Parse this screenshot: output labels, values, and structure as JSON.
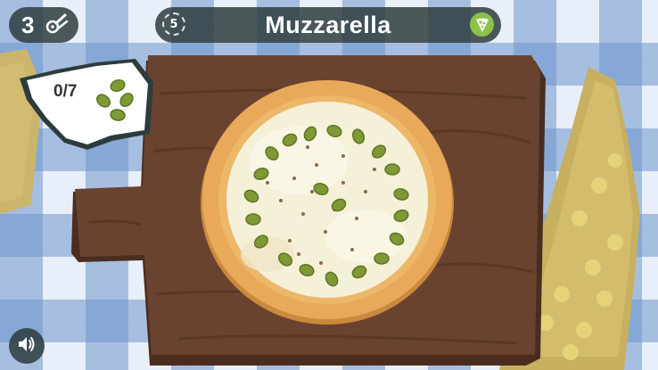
{
  "game": {
    "lives": "3",
    "level": "5",
    "pizza_name": "Muzzarella",
    "order_progress": "0/7",
    "topping": "olive"
  },
  "colors": {
    "hud_bg": "#2d3b3b",
    "board": "#5a3826",
    "crust": "#e8a95a",
    "cheese": "#f5f0d8",
    "olive": "#7f9a35",
    "accent_green": "#8bc34a"
  },
  "icons": {
    "lives": "pizza-cutter-icon",
    "level": "level-badge-icon",
    "pizza": "pizza-slice-icon",
    "order": "olives-icon",
    "sound": "speaker-icon"
  }
}
